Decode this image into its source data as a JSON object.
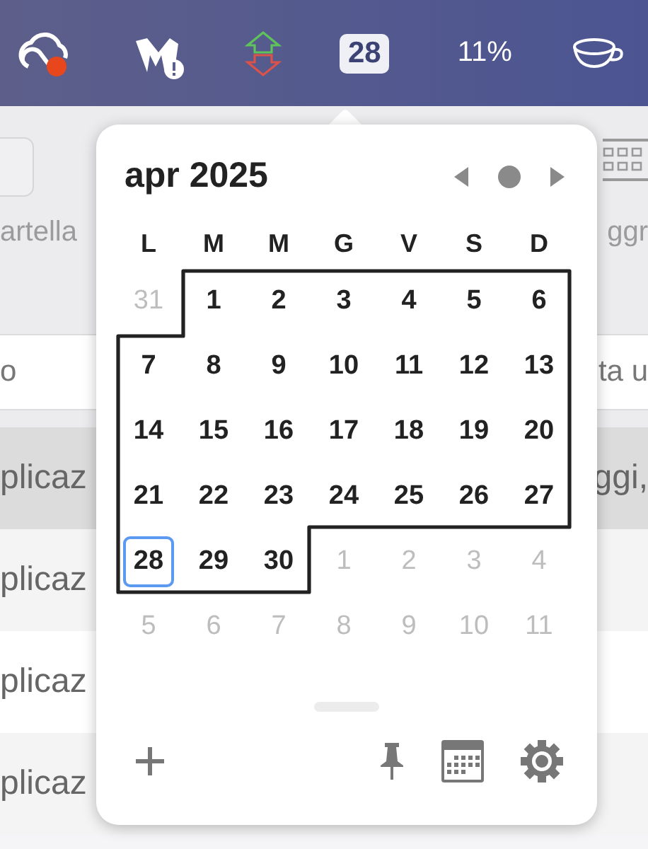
{
  "menu_bar": {
    "date_badge": "28",
    "battery": "11%"
  },
  "background": {
    "toolbar_labels": [
      "artella",
      "ggr"
    ],
    "header_cells": [
      "o",
      "ta u"
    ],
    "rows": [
      {
        "cells": [
          "plicaz",
          "ggi,"
        ],
        "selected": true
      },
      {
        "cells": [
          "plicaz"
        ],
        "selected": false
      },
      {
        "cells": [
          "plicaz"
        ],
        "selected": false
      },
      {
        "cells": [
          "plicaz"
        ],
        "selected": false
      }
    ]
  },
  "calendar": {
    "title": "apr 2025",
    "weekdays": [
      "L",
      "M",
      "M",
      "G",
      "V",
      "S",
      "D"
    ],
    "weeks": [
      [
        {
          "label": "31",
          "in_month": false,
          "today": false
        },
        {
          "label": "1",
          "in_month": true,
          "today": false
        },
        {
          "label": "2",
          "in_month": true,
          "today": false
        },
        {
          "label": "3",
          "in_month": true,
          "today": false
        },
        {
          "label": "4",
          "in_month": true,
          "today": false
        },
        {
          "label": "5",
          "in_month": true,
          "today": false
        },
        {
          "label": "6",
          "in_month": true,
          "today": false
        }
      ],
      [
        {
          "label": "7",
          "in_month": true,
          "today": false
        },
        {
          "label": "8",
          "in_month": true,
          "today": false
        },
        {
          "label": "9",
          "in_month": true,
          "today": false
        },
        {
          "label": "10",
          "in_month": true,
          "today": false
        },
        {
          "label": "11",
          "in_month": true,
          "today": false
        },
        {
          "label": "12",
          "in_month": true,
          "today": false
        },
        {
          "label": "13",
          "in_month": true,
          "today": false
        }
      ],
      [
        {
          "label": "14",
          "in_month": true,
          "today": false
        },
        {
          "label": "15",
          "in_month": true,
          "today": false
        },
        {
          "label": "16",
          "in_month": true,
          "today": false
        },
        {
          "label": "17",
          "in_month": true,
          "today": false
        },
        {
          "label": "18",
          "in_month": true,
          "today": false
        },
        {
          "label": "19",
          "in_month": true,
          "today": false
        },
        {
          "label": "20",
          "in_month": true,
          "today": false
        }
      ],
      [
        {
          "label": "21",
          "in_month": true,
          "today": false
        },
        {
          "label": "22",
          "in_month": true,
          "today": false
        },
        {
          "label": "23",
          "in_month": true,
          "today": false
        },
        {
          "label": "24",
          "in_month": true,
          "today": false
        },
        {
          "label": "25",
          "in_month": true,
          "today": false
        },
        {
          "label": "26",
          "in_month": true,
          "today": false
        },
        {
          "label": "27",
          "in_month": true,
          "today": false
        }
      ],
      [
        {
          "label": "28",
          "in_month": true,
          "today": true
        },
        {
          "label": "29",
          "in_month": true,
          "today": false
        },
        {
          "label": "30",
          "in_month": true,
          "today": false
        },
        {
          "label": "1",
          "in_month": false,
          "today": false
        },
        {
          "label": "2",
          "in_month": false,
          "today": false
        },
        {
          "label": "3",
          "in_month": false,
          "today": false
        },
        {
          "label": "4",
          "in_month": false,
          "today": false
        }
      ],
      [
        {
          "label": "5",
          "in_month": false,
          "today": false
        },
        {
          "label": "6",
          "in_month": false,
          "today": false
        },
        {
          "label": "7",
          "in_month": false,
          "today": false
        },
        {
          "label": "8",
          "in_month": false,
          "today": false
        },
        {
          "label": "9",
          "in_month": false,
          "today": false
        },
        {
          "label": "10",
          "in_month": false,
          "today": false
        },
        {
          "label": "11",
          "in_month": false,
          "today": false
        }
      ]
    ]
  }
}
